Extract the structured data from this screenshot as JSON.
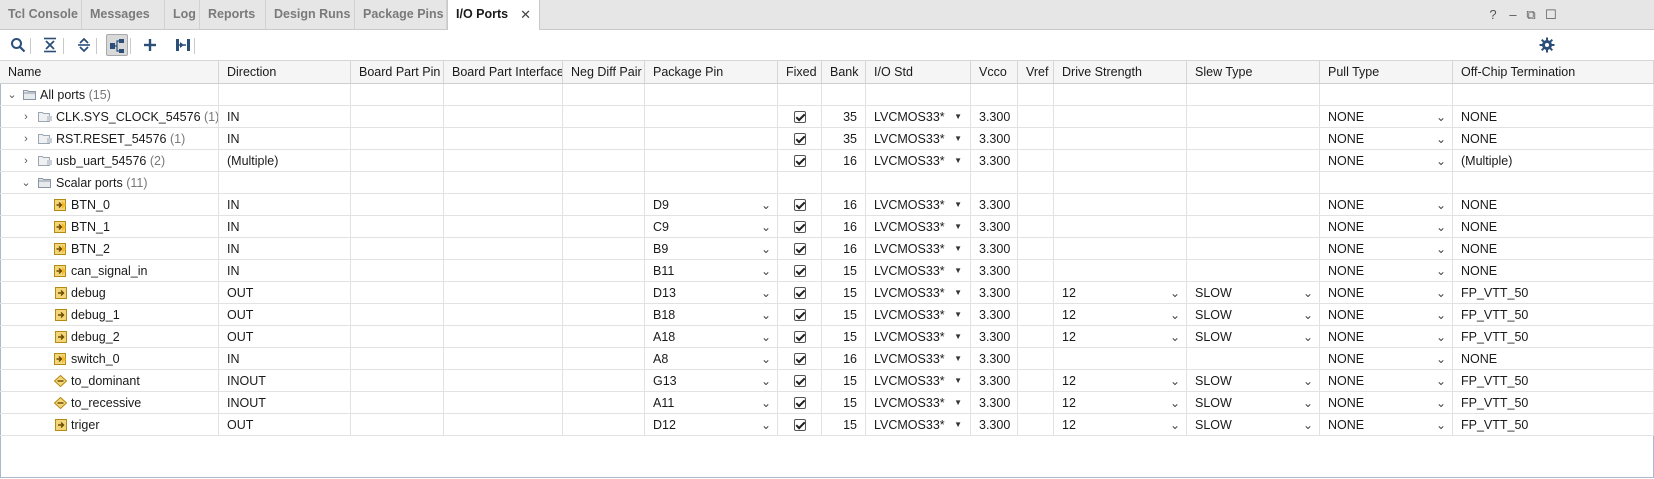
{
  "tabs": [
    {
      "label": "Tcl Console",
      "active": false
    },
    {
      "label": "Messages",
      "active": false
    },
    {
      "label": "Log",
      "active": false
    },
    {
      "label": "Reports",
      "active": false
    },
    {
      "label": "Design Runs",
      "active": false
    },
    {
      "label": "Package Pins",
      "active": false
    },
    {
      "label": "I/O Ports",
      "active": true
    }
  ],
  "window_controls": [
    "?",
    "–",
    "⧉",
    "☐"
  ],
  "toolbar_icons": [
    "search-icon",
    "collapse-all-icon",
    "expand-all-icon",
    "group-by-interface-icon",
    "add-icon",
    "export-icon"
  ],
  "settings_icon": "gear-icon",
  "columns": [
    "Name",
    "Direction",
    "Board Part Pin",
    "Board Part Interface",
    "Neg Diff Pair",
    "Package Pin",
    "Fixed",
    "Bank",
    "I/O Std",
    "Vcco",
    "Vref",
    "Drive Strength",
    "Slew Type",
    "Pull Type",
    "Off-Chip Termination"
  ],
  "root": {
    "label": "All ports",
    "count": "(15)"
  },
  "groups": [
    {
      "name": "CLK.SYS_CLOCK_54576",
      "count": "(1)",
      "direction": "IN",
      "bank": "35",
      "io_std": "LVCMOS33*",
      "vcco": "3.300",
      "pull": "NONE",
      "termination": "NONE"
    },
    {
      "name": "RST.RESET_54576",
      "count": "(1)",
      "direction": "IN",
      "bank": "35",
      "io_std": "LVCMOS33*",
      "vcco": "3.300",
      "pull": "NONE",
      "termination": "NONE"
    },
    {
      "name": "usb_uart_54576",
      "count": "(2)",
      "direction": "(Multiple)",
      "bank": "16",
      "io_std": "LVCMOS33*",
      "vcco": "3.300",
      "pull": "NONE",
      "termination": "(Multiple)"
    }
  ],
  "scalar_group": {
    "label": "Scalar ports",
    "count": "(11)"
  },
  "ports": [
    {
      "name": "BTN_0",
      "kind": "in",
      "direction": "IN",
      "pin": "D9",
      "bank": "16",
      "io_std": "LVCMOS33*",
      "vcco": "3.300",
      "drive": "",
      "slew": "",
      "pull": "NONE",
      "termination": "NONE"
    },
    {
      "name": "BTN_1",
      "kind": "in",
      "direction": "IN",
      "pin": "C9",
      "bank": "16",
      "io_std": "LVCMOS33*",
      "vcco": "3.300",
      "drive": "",
      "slew": "",
      "pull": "NONE",
      "termination": "NONE"
    },
    {
      "name": "BTN_2",
      "kind": "in",
      "direction": "IN",
      "pin": "B9",
      "bank": "16",
      "io_std": "LVCMOS33*",
      "vcco": "3.300",
      "drive": "",
      "slew": "",
      "pull": "NONE",
      "termination": "NONE"
    },
    {
      "name": "can_signal_in",
      "kind": "in",
      "direction": "IN",
      "pin": "B11",
      "bank": "15",
      "io_std": "LVCMOS33*",
      "vcco": "3.300",
      "drive": "",
      "slew": "",
      "pull": "NONE",
      "termination": "NONE"
    },
    {
      "name": "debug",
      "kind": "out",
      "direction": "OUT",
      "pin": "D13",
      "bank": "15",
      "io_std": "LVCMOS33*",
      "vcco": "3.300",
      "drive": "12",
      "slew": "SLOW",
      "pull": "NONE",
      "termination": "FP_VTT_50"
    },
    {
      "name": "debug_1",
      "kind": "out",
      "direction": "OUT",
      "pin": "B18",
      "bank": "15",
      "io_std": "LVCMOS33*",
      "vcco": "3.300",
      "drive": "12",
      "slew": "SLOW",
      "pull": "NONE",
      "termination": "FP_VTT_50"
    },
    {
      "name": "debug_2",
      "kind": "out",
      "direction": "OUT",
      "pin": "A18",
      "bank": "15",
      "io_std": "LVCMOS33*",
      "vcco": "3.300",
      "drive": "12",
      "slew": "SLOW",
      "pull": "NONE",
      "termination": "FP_VTT_50"
    },
    {
      "name": "switch_0",
      "kind": "in",
      "direction": "IN",
      "pin": "A8",
      "bank": "16",
      "io_std": "LVCMOS33*",
      "vcco": "3.300",
      "drive": "",
      "slew": "",
      "pull": "NONE",
      "termination": "NONE"
    },
    {
      "name": "to_dominant",
      "kind": "inout",
      "direction": "INOUT",
      "pin": "G13",
      "bank": "15",
      "io_std": "LVCMOS33*",
      "vcco": "3.300",
      "drive": "12",
      "slew": "SLOW",
      "pull": "NONE",
      "termination": "FP_VTT_50"
    },
    {
      "name": "to_recessive",
      "kind": "inout",
      "direction": "INOUT",
      "pin": "A11",
      "bank": "15",
      "io_std": "LVCMOS33*",
      "vcco": "3.300",
      "drive": "12",
      "slew": "SLOW",
      "pull": "NONE",
      "termination": "FP_VTT_50"
    },
    {
      "name": "triger",
      "kind": "out",
      "direction": "OUT",
      "pin": "D12",
      "bank": "15",
      "io_std": "LVCMOS33*",
      "vcco": "3.300",
      "drive": "12",
      "slew": "SLOW",
      "pull": "NONE",
      "termination": "FP_VTT_50"
    }
  ],
  "colors": {
    "accent": "#2c5a8c",
    "port_icon_in": "#d9a21b",
    "port_icon_out": "#d9a21b",
    "folder": "#9aa6b2"
  }
}
